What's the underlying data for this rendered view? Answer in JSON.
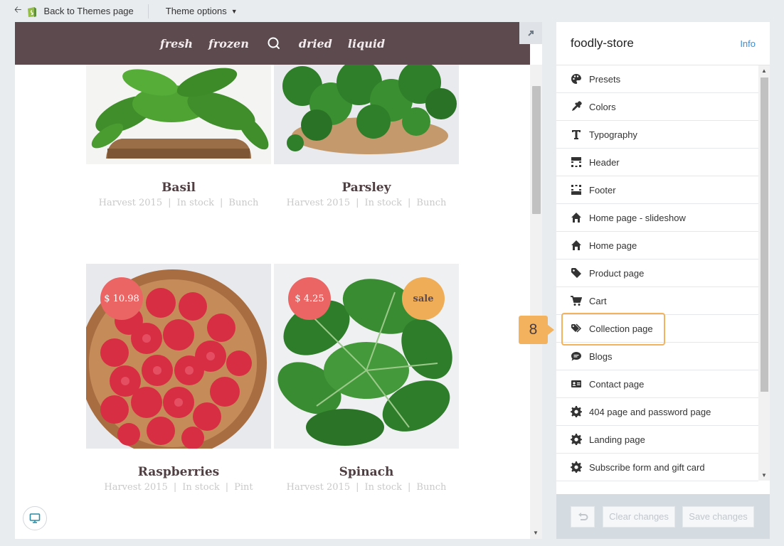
{
  "topbar": {
    "back_label": "Back to Themes page",
    "theme_options_label": "Theme options"
  },
  "preview": {
    "nav": [
      "fresh",
      "frozen",
      "dried",
      "liquid"
    ],
    "products": [
      {
        "title": "Basil",
        "meta": [
          "Harvest 2015",
          "In stock",
          "Bunch"
        ]
      },
      {
        "title": "Parsley",
        "meta": [
          "Harvest 2015",
          "In stock",
          "Bunch"
        ]
      },
      {
        "title": "Raspberries",
        "meta": [
          "Harvest 2015",
          "In stock",
          "Pint"
        ],
        "price": "$ 10.98"
      },
      {
        "title": "Spinach",
        "meta": [
          "Harvest 2015",
          "In stock",
          "Bunch"
        ],
        "price": "$ 4.25",
        "badge": "sale"
      }
    ]
  },
  "panel": {
    "store_name": "foodly-store",
    "info_label": "Info",
    "menu": [
      {
        "label": "Presets",
        "icon": "palette-icon"
      },
      {
        "label": "Colors",
        "icon": "eyedropper-icon"
      },
      {
        "label": "Typography",
        "icon": "typography-icon"
      },
      {
        "label": "Header",
        "icon": "header-layout-icon"
      },
      {
        "label": "Footer",
        "icon": "footer-layout-icon"
      },
      {
        "label": "Home page - slideshow",
        "icon": "home-icon"
      },
      {
        "label": "Home page",
        "icon": "home-icon"
      },
      {
        "label": "Product page",
        "icon": "tag-icon"
      },
      {
        "label": "Cart",
        "icon": "cart-icon"
      },
      {
        "label": "Collection page",
        "icon": "tags-icon"
      },
      {
        "label": "Blogs",
        "icon": "speech-bubble-icon"
      },
      {
        "label": "Contact page",
        "icon": "contact-card-icon"
      },
      {
        "label": "404 page and password page",
        "icon": "gear-icon"
      },
      {
        "label": "Landing page",
        "icon": "gear-icon"
      },
      {
        "label": "Subscribe form and gift card",
        "icon": "gear-icon"
      }
    ],
    "clear_label": "Clear changes",
    "save_label": "Save changes"
  },
  "callout": {
    "number": "8",
    "color": "#f3b25e"
  },
  "colors": {
    "nav_bg": "#5c4a4e",
    "price_badge": "#ec6565",
    "sale_badge": "#f0ad58",
    "link": "#3a8fd8"
  }
}
